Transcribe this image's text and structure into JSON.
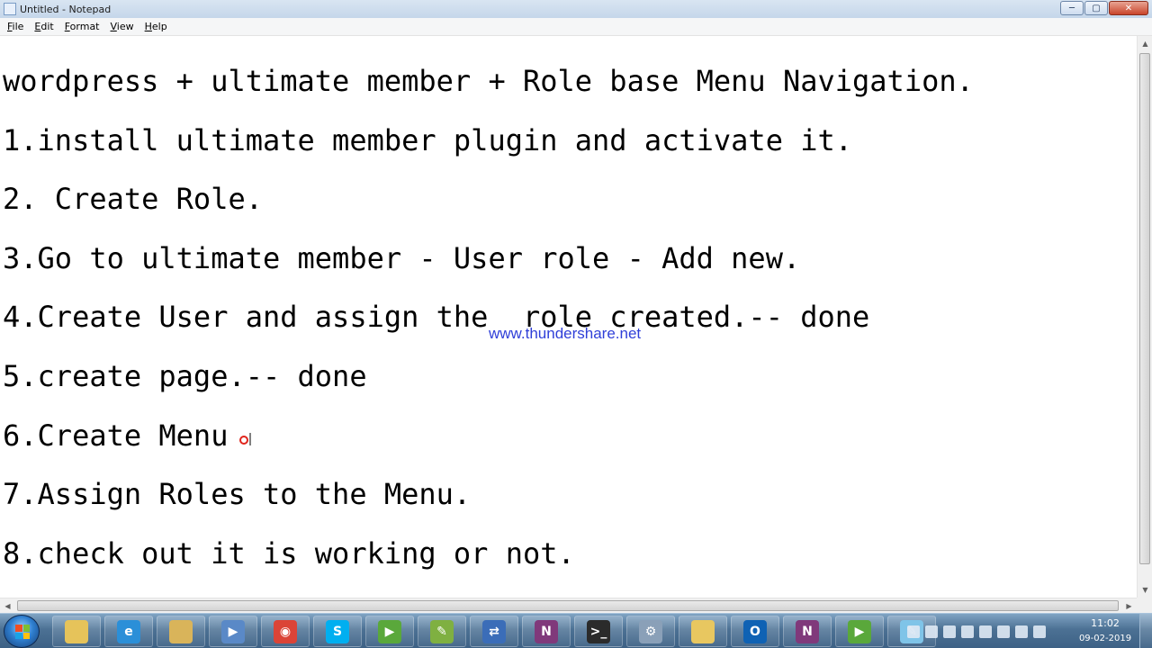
{
  "window": {
    "title": "Untitled - Notepad",
    "controls": {
      "minimize": "─",
      "maximize": "▢",
      "close": "✕"
    }
  },
  "menu": [
    "File",
    "Edit",
    "Format",
    "View",
    "Help"
  ],
  "editor": {
    "lines": [
      "wordpress + ultimate member + Role base Menu Navigation.",
      "1.install ultimate member plugin and activate it.",
      "2. Create Role.",
      "3.Go to ultimate member - User role - Add new.",
      "4.Create User and assign the  role created.-- done",
      "5.create page.-- done",
      "6.Create Menu",
      "7.Assign Roles to the Menu.",
      "8.check out it is working or not."
    ],
    "watermark": "www.thundershare.net"
  },
  "taskbar": {
    "apps": [
      {
        "icon": "file-explorer-icon",
        "color": "#e6c35a",
        "glyph": ""
      },
      {
        "icon": "internet-explorer-icon",
        "color": "#2b8fd8",
        "glyph": "e"
      },
      {
        "icon": "windows-explorer-icon",
        "color": "#d9b45a",
        "glyph": ""
      },
      {
        "icon": "media-player-icon",
        "color": "#5a89c7",
        "glyph": "▶"
      },
      {
        "icon": "chrome-icon",
        "color": "#db4437",
        "glyph": "◉"
      },
      {
        "icon": "skype-icon",
        "color": "#00aff0",
        "glyph": "S"
      },
      {
        "icon": "camtasia-recorder-icon",
        "color": "#5aa83b",
        "glyph": "▶"
      },
      {
        "icon": "notepad-plus-icon",
        "color": "#7fb041",
        "glyph": "✎"
      },
      {
        "icon": "network-tool-icon",
        "color": "#3b6db8",
        "glyph": "⇄"
      },
      {
        "icon": "onenote-icon",
        "color": "#80397b",
        "glyph": "N"
      },
      {
        "icon": "command-prompt-icon",
        "color": "#2b2b2b",
        "glyph": ">_"
      },
      {
        "icon": "settings-tool-icon",
        "color": "#8aa0b8",
        "glyph": "⚙"
      },
      {
        "icon": "folder-icon",
        "color": "#e8c760",
        "glyph": ""
      },
      {
        "icon": "outlook-icon",
        "color": "#0f62b4",
        "glyph": "O"
      },
      {
        "icon": "onenote-clipper-icon",
        "color": "#80397b",
        "glyph": "N"
      },
      {
        "icon": "camtasia-studio-icon",
        "color": "#5aa83b",
        "glyph": "▶"
      },
      {
        "icon": "notepad-icon",
        "color": "#7fc4e8",
        "glyph": "✎"
      }
    ],
    "tray_icons": [
      "camera-tray-icon",
      "outlook-tray-icon",
      "chrome-tray-icon",
      "onenote-tray-icon",
      "action-center-icon",
      "battery-icon",
      "volume-icon",
      "network-signal-icon"
    ],
    "clock": {
      "time": "11:02",
      "date": "09-02-2019"
    }
  }
}
